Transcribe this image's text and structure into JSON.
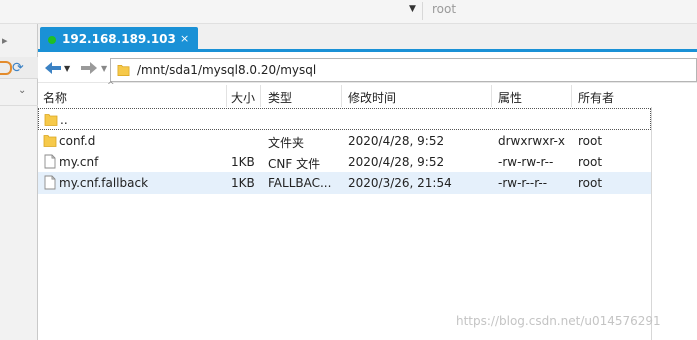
{
  "top": {
    "user": "root"
  },
  "tab": {
    "label": "192.168.189.103",
    "close": "×"
  },
  "path": "/mnt/sda1/mysql8.0.20/mysql",
  "columns": [
    "名称",
    "大小",
    "类型",
    "修改时间",
    "属性",
    "所有者"
  ],
  "rows": [
    {
      "name": "..",
      "size": "",
      "type": "",
      "modified": "",
      "attrs": "",
      "owner": "",
      "icon": "folder-icon"
    },
    {
      "name": "conf.d",
      "size": "",
      "type": "文件夹",
      "modified": "2020/4/28, 9:52",
      "attrs": "drwxrwxr-x",
      "owner": "root",
      "icon": "folder-icon"
    },
    {
      "name": "my.cnf",
      "size": "1KB",
      "type": "CNF 文件",
      "modified": "2020/4/28, 9:52",
      "attrs": "-rw-rw-r--",
      "owner": "root",
      "icon": "file-icon"
    },
    {
      "name": "my.cnf.fallback",
      "size": "1KB",
      "type": "FALLBAC...",
      "modified": "2020/3/26, 21:54",
      "attrs": "-rw-r--r--",
      "owner": "root",
      "icon": "file-icon"
    }
  ],
  "watermark": "https://blog.csdn.net/u014576291",
  "colors": {
    "accent": "#1a91d6",
    "online": "#1fbf26",
    "selected_row": "#e5f0fb",
    "folder": "#f6c94a"
  }
}
